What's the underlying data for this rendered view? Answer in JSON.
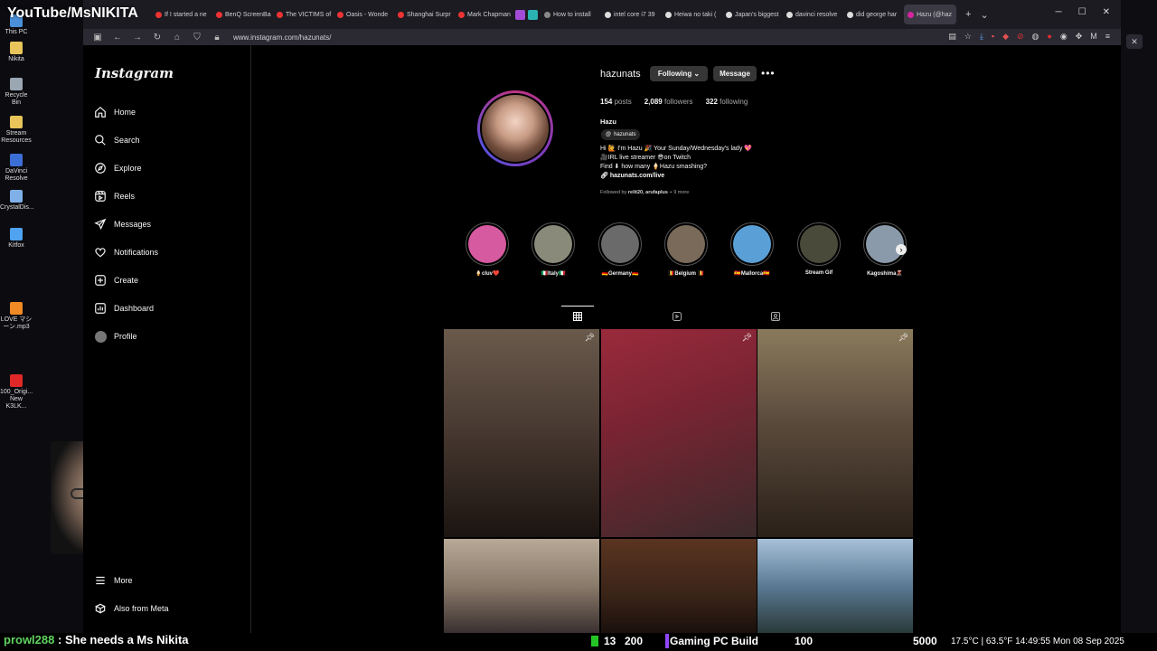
{
  "stream": {
    "title": "YouTube/MsNIKITA",
    "chat_user": "prowl288",
    "chat_sep": ":",
    "chat_message": "She needs a Ms Nikita",
    "counter_a": "13",
    "counter_b": "200",
    "build_label": "Gaming PC Build",
    "value_a": "100",
    "value_b": "5000",
    "weather": "17.5°C | 63.5°F  14:49:55  Mon 08 Sep 2025"
  },
  "desktop": {
    "icons": [
      {
        "label": "This PC",
        "color": "#4a90d9"
      },
      {
        "label": "Nikita",
        "color": "#e8c45a"
      },
      {
        "label": "Recycle Bin",
        "color": "#9aa6b2"
      },
      {
        "label": "Stream Resources",
        "color": "#e8c45a"
      },
      {
        "label": "DaVinci Resolve",
        "color": "#3c6fd6"
      },
      {
        "label": "CrystalDis...",
        "color": "#7fb1e8"
      },
      {
        "label": "Kitfox",
        "color": "#4fa3f0"
      },
      {
        "label": "LOVE マシーン.mp3",
        "color": "#f08a24"
      },
      {
        "label": "100_Origi... New K3LK...",
        "color": "#e02828"
      }
    ]
  },
  "browser": {
    "tabs": [
      {
        "label": "If I started a ne",
        "color": "#e33"
      },
      {
        "label": "BenQ ScreenBa",
        "color": "#e33"
      },
      {
        "label": "The VICTIMS of",
        "color": "#e33"
      },
      {
        "label": "Oasis - Wonde",
        "color": "#e33"
      },
      {
        "label": "Shanghai Surpr",
        "color": "#e33"
      },
      {
        "label": "Mark Chapman",
        "color": "#e33"
      },
      {
        "label": "",
        "color": "#a24bd6"
      },
      {
        "label": "",
        "color": "#2ab3b3"
      },
      {
        "label": "How to install",
        "color": "#888"
      },
      {
        "label": "intel core i7 39",
        "color": "#ddd"
      },
      {
        "label": "Heiwa no taki (",
        "color": "#ddd"
      },
      {
        "label": "Japan's biggest",
        "color": "#ddd"
      },
      {
        "label": "davinci resolve",
        "color": "#ddd"
      },
      {
        "label": "did george har",
        "color": "#ddd"
      },
      {
        "label": "Hazu (@haz",
        "color": "#d6249f",
        "active": true
      }
    ],
    "url": "www.instagram.com/hazunats/"
  },
  "instagram": {
    "logo": "Instagram",
    "nav": {
      "home": "Home",
      "search": "Search",
      "explore": "Explore",
      "reels": "Reels",
      "messages": "Messages",
      "notifications": "Notifications",
      "create": "Create",
      "dashboard": "Dashboard",
      "profile": "Profile",
      "more": "More",
      "meta": "Also from Meta"
    },
    "profile": {
      "username": "hazunats",
      "following_btn": "Following ⌄",
      "message_btn": "Message",
      "posts_count": "154",
      "posts_label": "posts",
      "followers_count": "2,089",
      "followers_label": "followers",
      "following_count": "322",
      "following_label": "following",
      "display_name": "Hazu",
      "threads_handle": "hazunats",
      "bio_line1": "Hi 🙋 I'm Hazu 🎉  Your Sunday/Wednesday's lady 💖",
      "bio_line2": "🎥IRL live streamer 😎on Twitch",
      "bio_line3": "Find ⬇ how many 🍦Hazu smashing?",
      "bio_link": "hazunats.com/live",
      "followed_prefix": "Followed by",
      "followed_names": "relit20, arufaplus",
      "followed_more": "+ 9 more"
    },
    "highlights": [
      {
        "label": "🍦cluv❤️",
        "color": "#d65aa0"
      },
      {
        "label": "🇮🇹Italy🇮🇹",
        "color": "#8a8a7a"
      },
      {
        "label": "🇩🇪Germany🇩🇪",
        "color": "#6a6a6a"
      },
      {
        "label": "🇧🇪Belgium 🇧🇪",
        "color": "#7a6a5a"
      },
      {
        "label": "🇪🇸Mallorca🇪🇸",
        "color": "#5aa0d6"
      },
      {
        "label": "Stream Gif",
        "color": "#4a4a3a"
      },
      {
        "label": "Kagoshima🌋",
        "color": "#8a9aaa"
      }
    ],
    "posts": [
      {
        "color": "#4a3b33",
        "pinned": true
      },
      {
        "color": "#7a2433",
        "pinned": true
      },
      {
        "color": "#5a4a3c",
        "pinned": true
      },
      {
        "color": "#8a7a6a",
        "pinned": false
      },
      {
        "color": "#3a2418",
        "pinned": false
      },
      {
        "color": "#5a7a94",
        "pinned": false
      }
    ]
  }
}
